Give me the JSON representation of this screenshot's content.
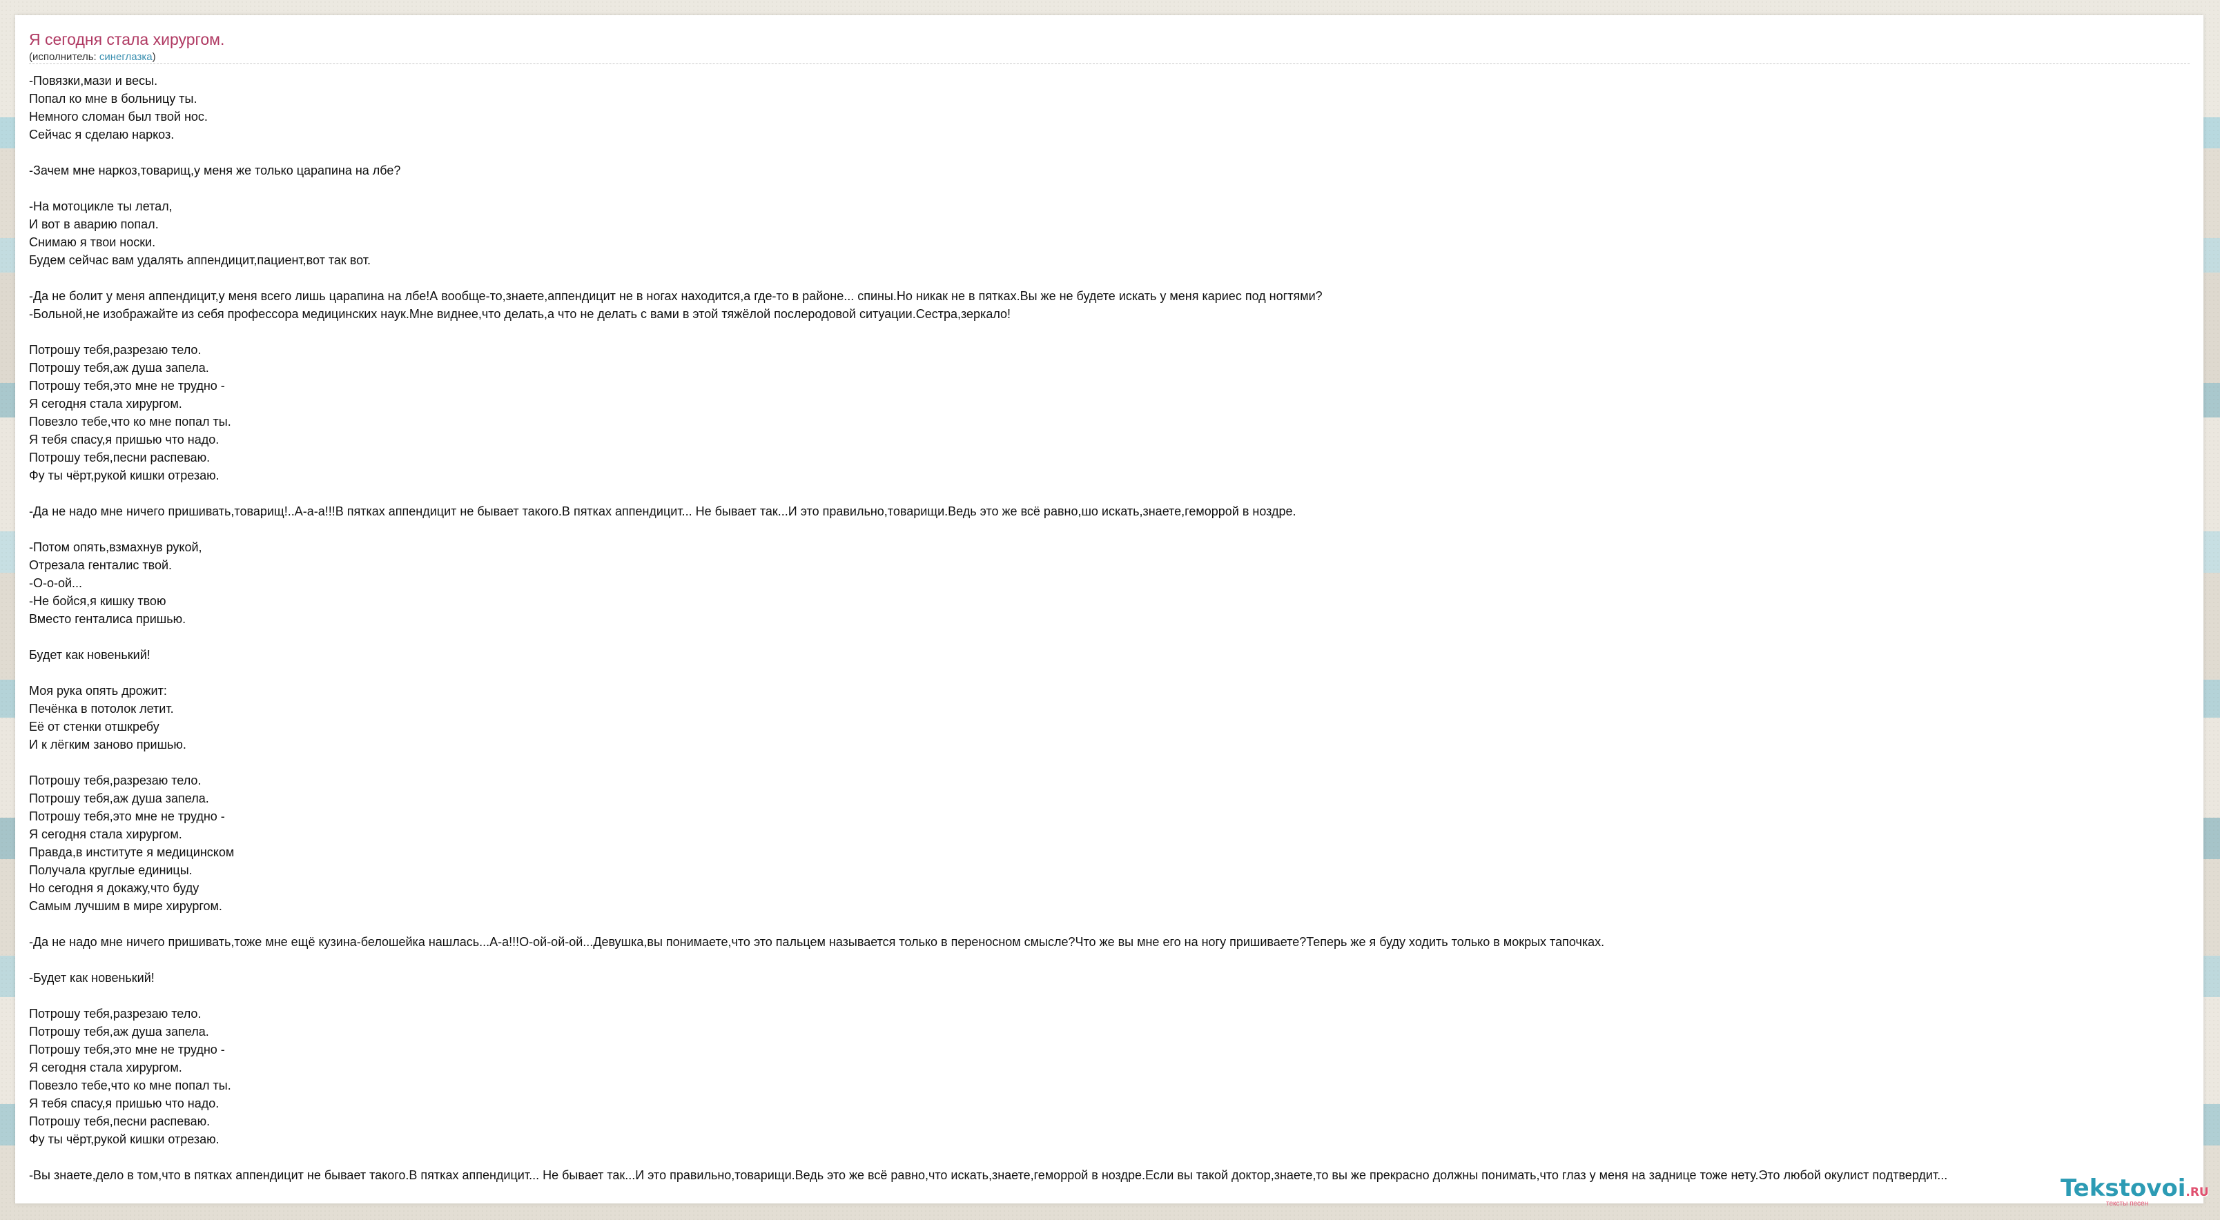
{
  "page": {
    "title": "Я сегодня стала хирургом.",
    "performer_prefix": "(исполнитель: ",
    "performer_name": "синеглазка",
    "performer_suffix": ")"
  },
  "lyrics": [
    "-Повязки,мази и весы.",
    "Попал ко мне в больницу ты.",
    "Немного сломан был твой нос.",
    "Сейчас я сделаю наркоз.",
    "",
    "-Зачем мне наркоз,товарищ,у меня же только царапина на лбе?",
    "",
    "-На мотоцикле ты летал,",
    "И вот в аварию попал.",
    "Снимаю я твои носки.",
    "Будем сейчас вам удалять аппендицит,пациент,вот так вот.",
    "",
    "-Да не болит у меня аппендицит,у меня всего лишь царапина на лбе!А вообще-то,знаете,аппендицит не в ногах находится,а где-то в районе... спины.Но никак не в пятках.Вы же не будете искать у меня кариес под ногтями?",
    "-Больной,не изображайте из себя профессора медицинских наук.Мне виднее,что делать,а что не делать с вами в этой тяжёлой послеродовой ситуации.Сестра,зеркало!",
    "",
    "Потрошу тебя,разрезаю тело.",
    "Потрошу тебя,аж душа запела.",
    "Потрошу тебя,это мне не трудно -",
    "Я сегодня стала хирургом.",
    "Повезло тебе,что ко мне попал ты.",
    "Я тебя спасу,я пришью что надо.",
    "Потрошу тебя,песни распеваю.",
    "Фу ты чёрт,рукой кишки отрезаю.",
    "",
    "-Да не надо мне ничего пришивать,товарищ!..А-а-а!!!В пятках аппендицит не бывает такого.В пятках аппендицит... Не бывает так...И это правильно,товарищи.Ведь это же всё равно,шо искать,знаете,геморрой в ноздре.",
    "",
    "-Потом опять,взмахнув рукой,",
    "Отрезала генталис твой.",
    "-О-о-ой...",
    "-Не бойся,я кишку твою",
    "Вместо генталиса пришью.",
    "",
    "Будет как новенький!",
    "",
    "Моя рука опять дрожит:",
    "Печёнка в потолок летит.",
    "Её от стенки отшкребу",
    "И к лёгким заново пришью.",
    "",
    "Потрошу тебя,разрезаю тело.",
    "Потрошу тебя,аж душа запела.",
    "Потрошу тебя,это мне не трудно -",
    "Я сегодня стала хирургом.",
    "Правда,в институте я медицинском",
    "Получала круглые единицы.",
    "Но сегодня я докажу,что буду",
    "Самым лучшим в мире хирургом.",
    "",
    "-Да не надо мне ничего пришивать,тоже мне ещё кузина-белошейка нашлась...А-а!!!О-ой-ой-ой...Девушка,вы понимаете,что это пальцем называется только в переносном смысле?Что же вы мне его на ногу пришиваете?Теперь же я буду ходить только в мокрых тапочках.",
    "",
    "-Будет как новенький!",
    "",
    "Потрошу тебя,разрезаю тело.",
    "Потрошу тебя,аж душа запела.",
    "Потрошу тебя,это мне не трудно -",
    "Я сегодня стала хирургом.",
    "Повезло тебе,что ко мне попал ты.",
    "Я тебя спасу,я пришью что надо.",
    "Потрошу тебя,песни распеваю.",
    "Фу ты чёрт,рукой кишки отрезаю.",
    "",
    "-Вы знаете,дело в том,что в пятках аппендицит не бывает такого.В пятках аппендицит... Не бывает так...И это правильно,товарищи.Ведь это же всё равно,что искать,знаете,геморрой в ноздре.Если вы такой доктор,знаете,то вы же прекрасно должны понимать,что глаз у меня на заднице тоже нету.Это любой окулист подтвердит..."
  ],
  "brand": {
    "name": "Tekstovoi",
    "tld": ".RU",
    "tagline": "тексты песен"
  },
  "colors": {
    "title": "#b03a63",
    "link": "#3a8fb0",
    "logo": "#2c9bb4",
    "logo_accent": "#e0506f"
  }
}
